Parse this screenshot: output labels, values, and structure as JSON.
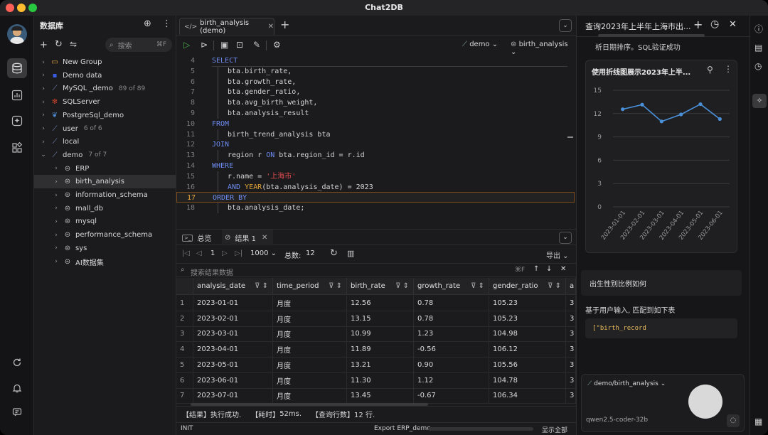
{
  "window": {
    "title": "Chat2DB"
  },
  "colors": {
    "accent_blue": "#4a90d9",
    "keyword": "#6e8cf0",
    "string": "#e04b4b",
    "function": "#e0a33a",
    "run_green": "#4caf50"
  },
  "activity_bar": {
    "top_icons": [
      "avatar",
      "database-icon",
      "chart-icon",
      "ai-icon",
      "grid-icon"
    ],
    "bottom_icons": [
      "refresh-icon",
      "bell-icon",
      "chat-icon"
    ]
  },
  "sidebar": {
    "title": "数据库",
    "search_placeholder": "搜索",
    "search_shortcut": "⌘F",
    "items": [
      {
        "label": "New Group",
        "icon": "folder-icon",
        "count": ""
      },
      {
        "label": "Demo data",
        "icon": "demo-icon",
        "count": ""
      },
      {
        "label": "MySQL _demo",
        "icon": "mysql-icon",
        "count": "89 of 89"
      },
      {
        "label": "SQLServer",
        "icon": "sqlserver-icon",
        "count": ""
      },
      {
        "label": "PostgreSql_demo",
        "icon": "postgres-icon",
        "count": ""
      },
      {
        "label": "user",
        "icon": "mysql-icon",
        "count": "6 of 6"
      },
      {
        "label": "local",
        "icon": "mysql-icon",
        "count": ""
      },
      {
        "label": "demo",
        "icon": "mysql-icon",
        "count": "7 of 7"
      },
      {
        "label": "ERP",
        "icon": "db-icon",
        "count": ""
      },
      {
        "label": "birth_analysis",
        "icon": "db-icon",
        "count": ""
      },
      {
        "label": "information_schema",
        "icon": "db-icon",
        "count": ""
      },
      {
        "label": "mall_db",
        "icon": "db-icon",
        "count": ""
      },
      {
        "label": "mysql",
        "icon": "db-icon",
        "count": ""
      },
      {
        "label": "performance_schema",
        "icon": "db-icon",
        "count": ""
      },
      {
        "label": "sys",
        "icon": "db-icon",
        "count": ""
      },
      {
        "label": "AI数据集",
        "icon": "db-icon",
        "count": ""
      }
    ]
  },
  "editor": {
    "tab_label": "birth_analysis (demo)",
    "datasource": "demo",
    "database": "birth_analysis",
    "lines": [
      {
        "n": "4",
        "text": "SELECT"
      },
      {
        "n": "5",
        "text": "bta.birth_rate,"
      },
      {
        "n": "6",
        "text": "bta.growth_rate,"
      },
      {
        "n": "7",
        "text": "bta.gender_ratio,"
      },
      {
        "n": "8",
        "text": "bta.avg_birth_weight,"
      },
      {
        "n": "9",
        "text": "bta.analysis_result"
      },
      {
        "n": "10",
        "text": "FROM"
      },
      {
        "n": "11",
        "text": "birth_trend_analysis bta"
      },
      {
        "n": "12",
        "text": "JOIN"
      },
      {
        "n": "13",
        "text": "region r ON bta.region_id = r.id"
      },
      {
        "n": "14",
        "text": "WHERE"
      },
      {
        "n": "15",
        "text": "r.name = '上海市'"
      },
      {
        "n": "16",
        "text": "AND YEAR(bta.analysis_date) = 2023"
      },
      {
        "n": "17",
        "text": "ORDER BY"
      },
      {
        "n": "18",
        "text": "bta.analysis_date;"
      }
    ]
  },
  "results": {
    "tab_overview": "总览",
    "tab_result": "结果 1",
    "page": "1",
    "page_size": "1000",
    "total_label": "总数:",
    "total": "12",
    "export_label": "导出",
    "search_placeholder": "搜索结果数据",
    "search_shortcut": "⌘F",
    "columns": [
      "analysis_date",
      "time_period",
      "birth_rate",
      "growth_rate",
      "gender_ratio",
      "a"
    ],
    "rows": [
      [
        "1",
        "2023-01-01",
        "月度",
        "12.56",
        "0.78",
        "105.23",
        "3"
      ],
      [
        "2",
        "2023-02-01",
        "月度",
        "13.15",
        "0.78",
        "105.23",
        "3"
      ],
      [
        "3",
        "2023-03-01",
        "月度",
        "10.99",
        "1.23",
        "104.98",
        "3"
      ],
      [
        "4",
        "2023-04-01",
        "月度",
        "11.89",
        "-0.56",
        "106.12",
        "3"
      ],
      [
        "5",
        "2023-05-01",
        "月度",
        "13.21",
        "0.90",
        "105.56",
        "3"
      ],
      [
        "6",
        "2023-06-01",
        "月度",
        "11.30",
        "1.12",
        "104.78",
        "3"
      ],
      [
        "7",
        "2023-07-01",
        "月度",
        "13.45",
        "-0.67",
        "106.34",
        "3"
      ]
    ],
    "status_result": "【结果】执行成功.",
    "status_time_label": "【耗时】",
    "status_time": "52ms.",
    "status_rows_label": "【查询行数】",
    "status_rows": "12 行."
  },
  "statusbar": {
    "left": "INIT",
    "center": "Export ERP_demo",
    "right": "显示全部"
  },
  "chat": {
    "title": "查询2023年上半年上海市出...",
    "msg_top": "析日期排序。SQL验证成功",
    "chart_card_title": "使用折线图展示2023年上半...",
    "user_msg": "出生性别比例如何",
    "reply_text": "基于用户输入, 匹配到如下表",
    "code_snippet": "[\"birth_record",
    "context": "demo/birth_analysis",
    "model": "qwen2.5-coder-32b"
  },
  "chart_data": {
    "type": "line",
    "x": [
      "2023-01-01",
      "2023-02-01",
      "2023-03-01",
      "2023-04-01",
      "2023-05-01",
      "2023-06-01"
    ],
    "series": [
      {
        "values": [
          12.56,
          13.15,
          10.99,
          11.89,
          13.21,
          11.3
        ]
      }
    ],
    "yticks": [
      "0",
      "3",
      "6",
      "9",
      "12",
      "15"
    ],
    "ylim": [
      0,
      15
    ],
    "grid": true,
    "color": "#4a90d9"
  }
}
